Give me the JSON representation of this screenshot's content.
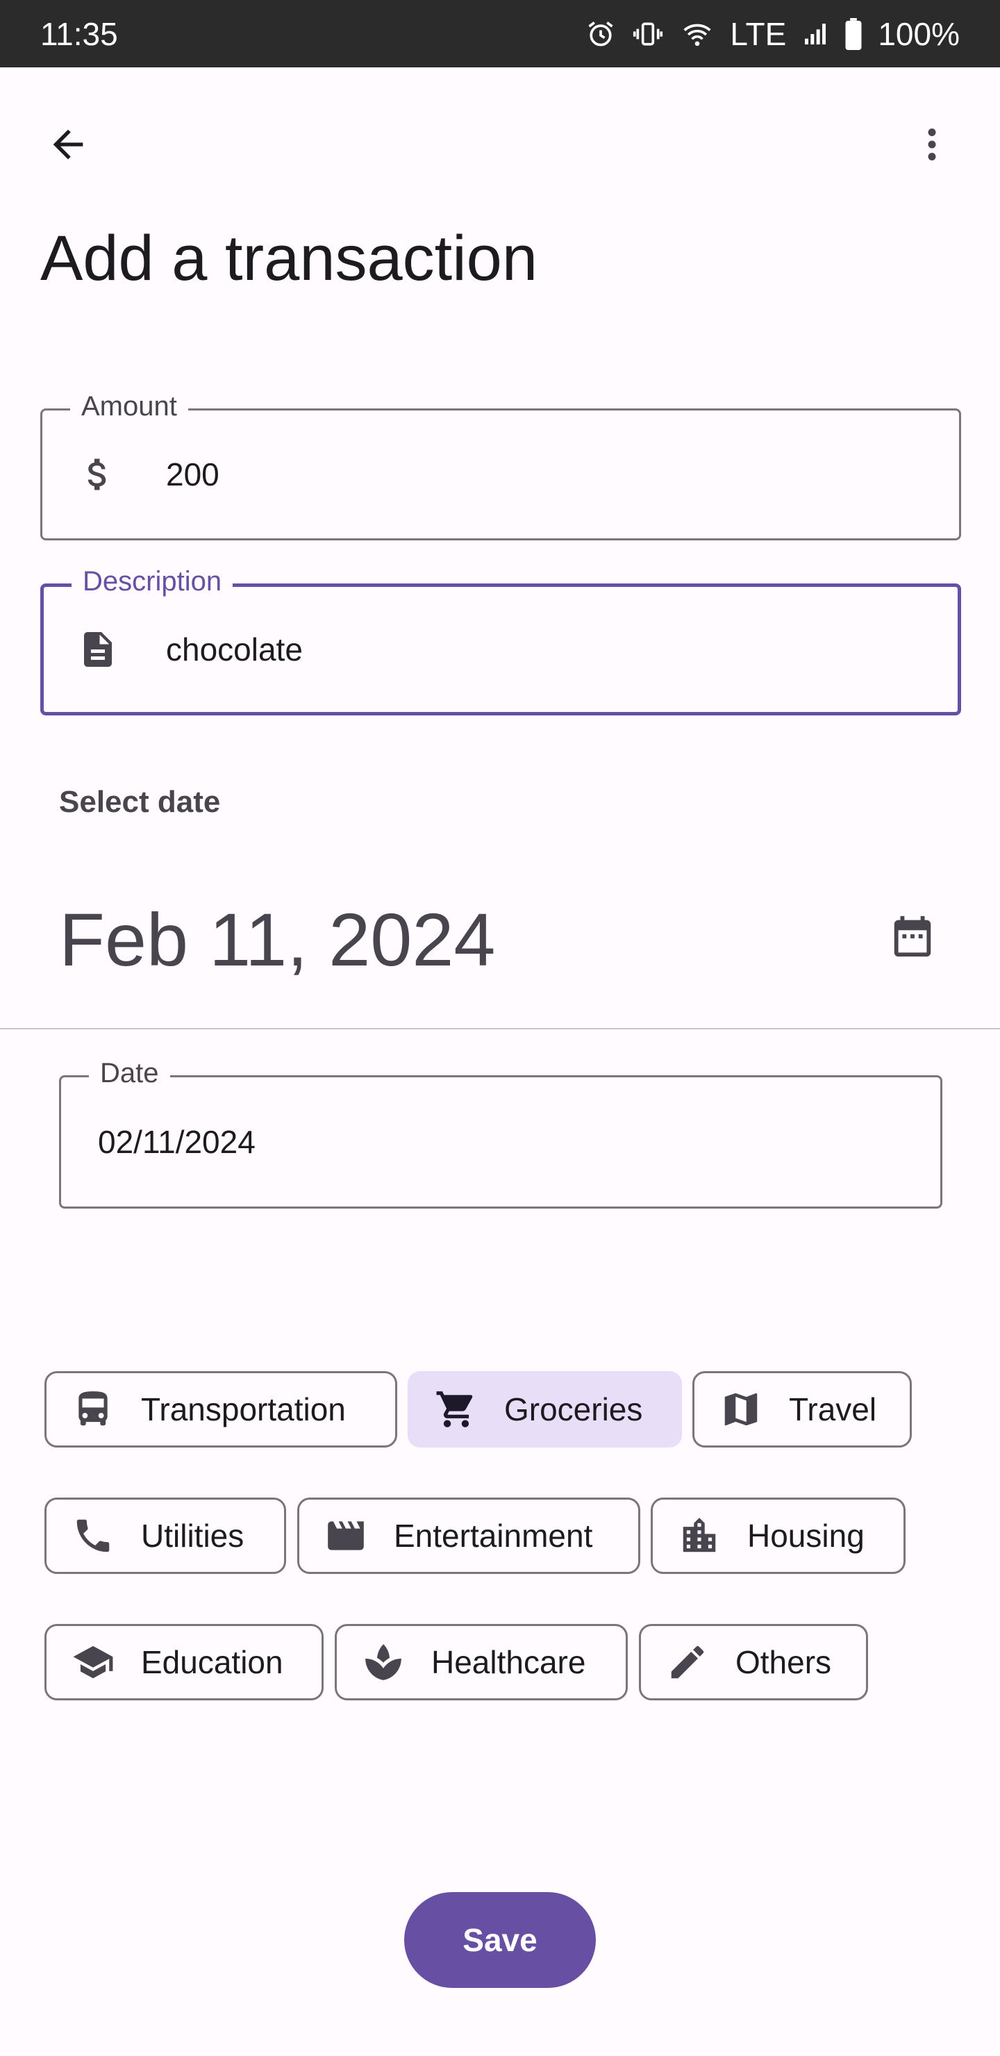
{
  "status_bar": {
    "time": "11:35",
    "network": "LTE",
    "battery": "100%"
  },
  "header": {
    "title": "Add a transaction"
  },
  "amount_field": {
    "label": "Amount",
    "value": "200"
  },
  "description_field": {
    "label": "Description",
    "value": "chocolate"
  },
  "date_picker": {
    "heading": "Select date",
    "selected_date": "Feb 11, 2024"
  },
  "date_field": {
    "label": "Date",
    "value": "02/11/2024"
  },
  "categories": [
    {
      "label": "Transportation",
      "icon": "bus-icon",
      "selected": false
    },
    {
      "label": "Groceries",
      "icon": "cart-icon",
      "selected": true
    },
    {
      "label": "Travel",
      "icon": "map-icon",
      "selected": false
    },
    {
      "label": "Utilities",
      "icon": "phone-icon",
      "selected": false
    },
    {
      "label": "Entertainment",
      "icon": "clapperboard-icon",
      "selected": false
    },
    {
      "label": "Housing",
      "icon": "building-icon",
      "selected": false
    },
    {
      "label": "Education",
      "icon": "graduation-cap-icon",
      "selected": false
    },
    {
      "label": "Healthcare",
      "icon": "spa-icon",
      "selected": false
    },
    {
      "label": "Others",
      "icon": "pencil-icon",
      "selected": false
    }
  ],
  "actions": {
    "save_label": "Save"
  },
  "colors": {
    "primary": "#6750a4",
    "selected_chip": "#e8def8",
    "status_bar": "#2b2b2b",
    "background": "#fffbfe"
  }
}
